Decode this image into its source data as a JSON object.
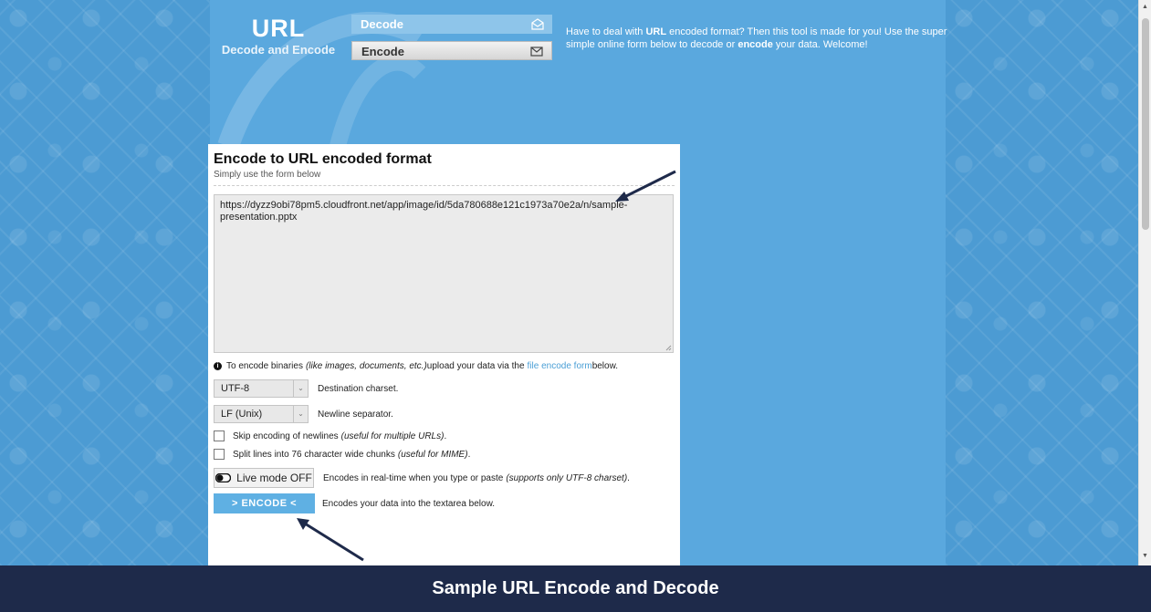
{
  "logo": {
    "title": "URL",
    "subtitle": "Decode and Encode"
  },
  "tabs": {
    "decode": "Decode",
    "encode": "Encode"
  },
  "intro": {
    "p1": "Have to deal with ",
    "b1": "URL",
    "p2": " encoded format? Then this tool is made for you! Use the super simple online form below to decode or ",
    "b2": "encode",
    "p3": " your data. Welcome!"
  },
  "panel": {
    "title": "Encode to URL encoded format",
    "subtitle": "Simply use the form below",
    "input_value": "https://dyzz9obi78pm5.cloudfront.net/app/image/id/5da780688e121c1973a70e2a/n/sample-presentation.pptx"
  },
  "binary_note": {
    "before": "To encode binaries ",
    "italic": "(like images, documents, etc.)",
    "middle": " upload your data via the ",
    "link": "file encode form",
    "after": " below."
  },
  "charset": {
    "value": "UTF-8",
    "label": "Destination charset."
  },
  "newline": {
    "value": "LF (Unix)",
    "label": "Newline separator."
  },
  "skip_newlines": {
    "text": "Skip encoding of newlines ",
    "hint": "(useful for multiple URLs)",
    "end": "."
  },
  "split_lines": {
    "text": "Split lines into 76 character wide chunks ",
    "hint": "(useful for MIME)",
    "end": "."
  },
  "live_mode": {
    "label": "Live mode OFF",
    "text": "Encodes in real-time when you type or paste ",
    "hint": "(supports only UTF-8 charset)",
    "end": "."
  },
  "encode": {
    "label": "> ENCODE <",
    "text": "Encodes your data into the textarea below."
  },
  "caption": "Sample URL Encode and Decode",
  "colors": {
    "background_blue": "#5aa8de",
    "accent": "#5fb0e3",
    "caption_bar": "#1e2a4a",
    "arrow": "#1e2a4a"
  }
}
